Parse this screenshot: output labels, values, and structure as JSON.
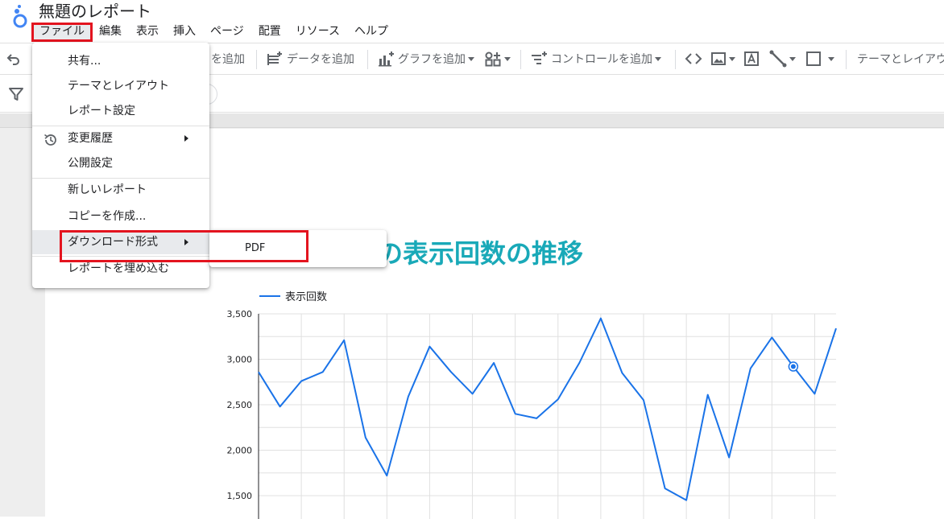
{
  "app": {
    "doc_title": "無題のレポート",
    "logo_icon": "looker-studio-logo-icon"
  },
  "menubar": {
    "items": [
      "ファイル",
      "編集",
      "表示",
      "挿入",
      "ページ",
      "配置",
      "リソース",
      "ヘルプ"
    ],
    "active": "ファイル"
  },
  "toolbar": {
    "add_page_partial": "を追加",
    "add_data": "データを追加",
    "add_chart": "グラフを追加",
    "add_control": "コントロールを追加",
    "theme_layout": "テーマとレイアウト"
  },
  "file_menu": {
    "share": "共有...",
    "theme_layout": "テーマとレイアウト",
    "report_settings": "レポート設定",
    "version_history": "変更履歴",
    "publish_settings": "公開設定",
    "new_report": "新しいレポート",
    "make_copy": "コピーを作成...",
    "download_as": "ダウンロード形式",
    "embed_report": "レポートを埋め込む"
  },
  "download_submenu": {
    "pdf": "PDF"
  },
  "report": {
    "title_partial": "の表示回数の推移"
  },
  "accent_color": "#19a9b8",
  "highlight_color": "#e3141f",
  "chart_data": {
    "type": "line",
    "series": [
      {
        "name": "表示回数",
        "color": "#1a73e8",
        "values": [
          2860,
          2480,
          2760,
          2860,
          3210,
          2140,
          1720,
          2590,
          3140,
          2860,
          2620,
          2960,
          2400,
          2350,
          2560,
          2960,
          3450,
          2850,
          2550,
          1580,
          1450,
          2610,
          1920,
          2900,
          3240,
          2920,
          2620,
          3340
        ]
      }
    ],
    "yticks": [
      "3,500",
      "3,000",
      "2,500",
      "2,000",
      "1,500"
    ],
    "ylim": [
      1300,
      3500
    ],
    "highlight_point_index": 25,
    "legend": "top-left",
    "grid": true
  }
}
